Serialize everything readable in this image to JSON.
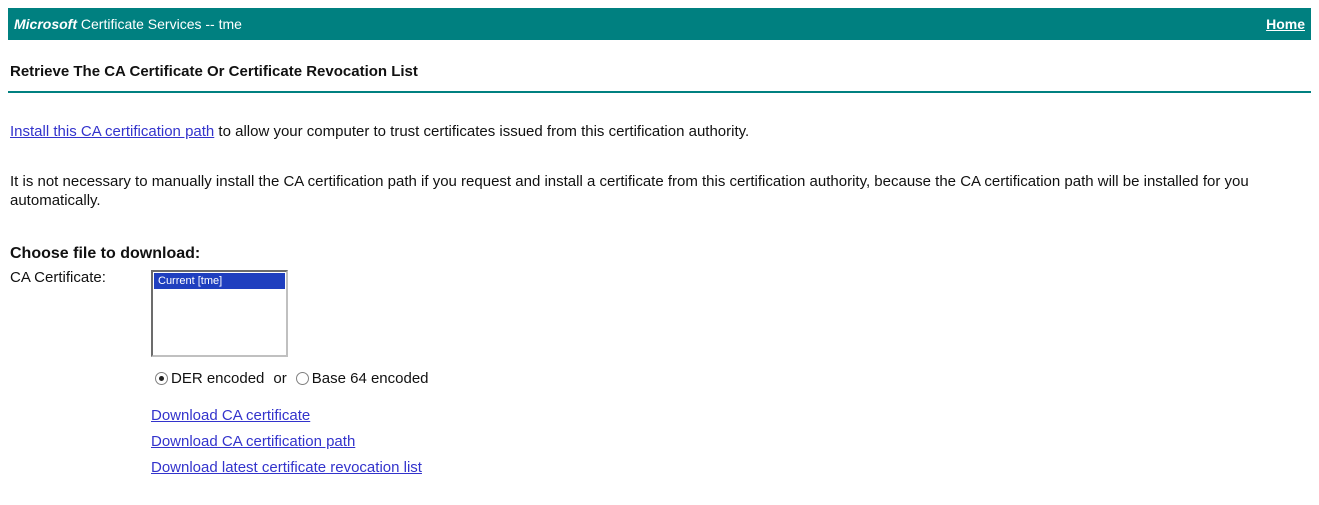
{
  "header": {
    "brand": "Microsoft",
    "title": "Certificate Services  --  tme",
    "home_link": "Home",
    "bar_color": "#008080"
  },
  "page": {
    "title": "Retrieve The CA Certificate Or Certificate Revocation List",
    "install_link": "Install this CA certification path",
    "install_text": " to allow your computer to trust certificates issued from this certification authority.",
    "note": "It is not necessary to manually install the CA certification path if you request and install a certificate from this certification authority, because the CA certification path will be installed for you automatically."
  },
  "download": {
    "heading": "Choose file to download:",
    "ca_label": "CA Certificate:",
    "listbox_items": [
      "Current [tme]"
    ],
    "selected_item": "Current [tme]",
    "encoding": {
      "der_label": "DER encoded",
      "or_label": "or",
      "base64_label": "Base 64 encoded",
      "selected": "DER encoded"
    },
    "links": {
      "ca_certificate": "Download CA certificate",
      "ca_path": "Download CA certification path",
      "crl": "Download latest certificate revocation list"
    }
  },
  "colors": {
    "link": "#3333cc",
    "accent": "#008080",
    "selection": "#1f3fbf"
  }
}
